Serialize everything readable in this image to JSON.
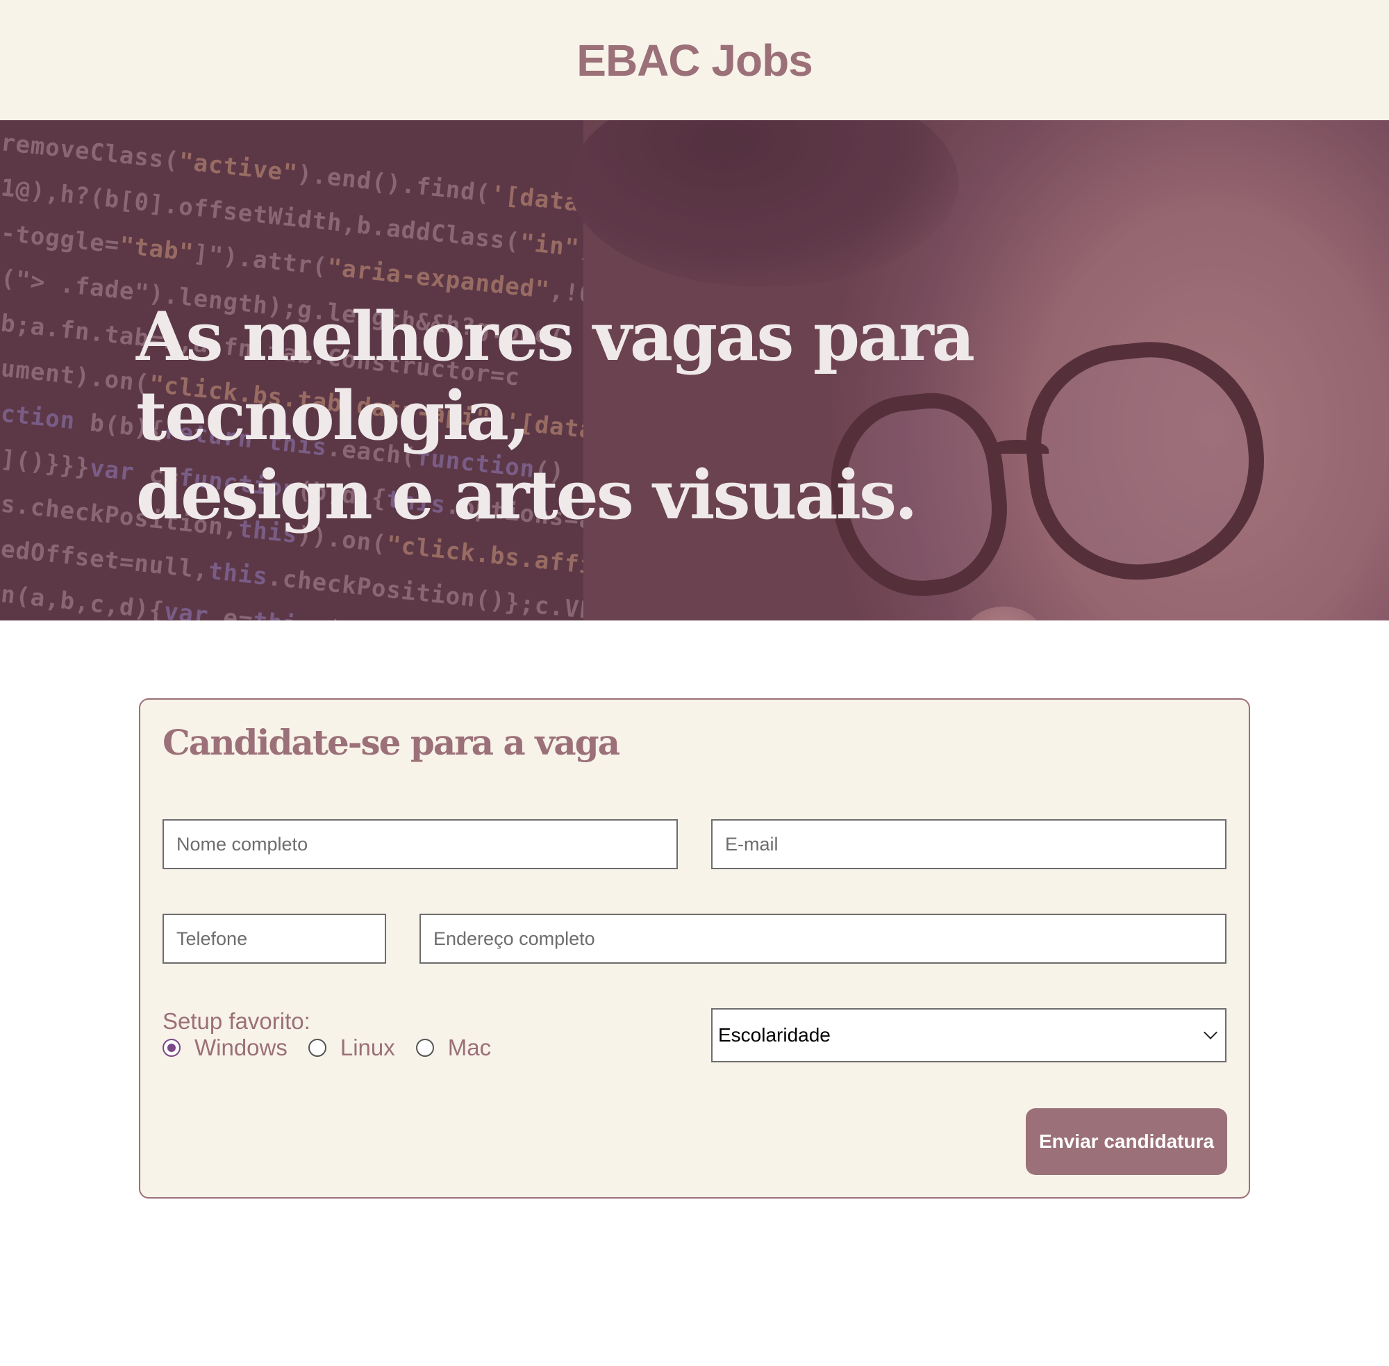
{
  "header": {
    "brand": "EBAC Jobs"
  },
  "hero": {
    "title_line1": "As melhores vagas para tecnologia,",
    "title_line2": "design e artes visuais."
  },
  "form": {
    "title": "Candidate-se para a vaga",
    "name_placeholder": "Nome completo",
    "email_placeholder": "E-mail",
    "phone_placeholder": "Telefone",
    "address_placeholder": "Endereço completo",
    "setup_label": "Setup favorito:",
    "setup_options": [
      {
        "label": "Windows",
        "checked": true
      },
      {
        "label": "Linux",
        "checked": false
      },
      {
        "label": "Mac",
        "checked": false
      }
    ],
    "education_select": "Escolaridade",
    "submit_label": "Enviar candidatura"
  },
  "colors": {
    "accent": "#9b7078",
    "cream": "#f8f3e9",
    "radio_checked": "#7a4a86"
  }
}
